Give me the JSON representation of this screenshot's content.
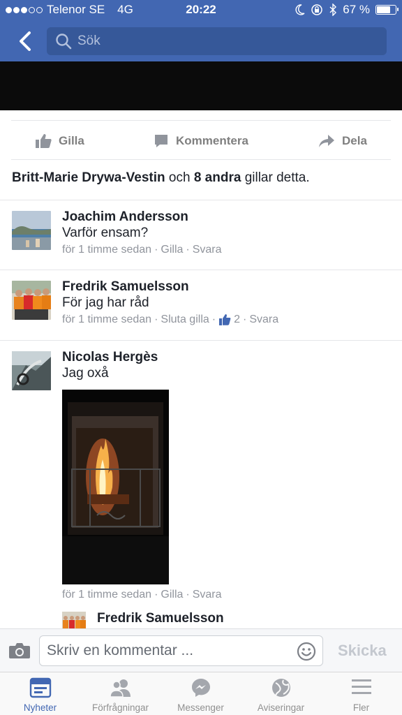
{
  "status_bar": {
    "carrier": "Telenor SE",
    "network": "4G",
    "time": "20:22",
    "battery": "67 %",
    "battery_level": 0.67,
    "signal_bars_filled": 3,
    "signal_bars_total": 5
  },
  "header": {
    "search_placeholder": "Sök",
    "accent_color": "#4267b2"
  },
  "actions": {
    "like": "Gilla",
    "comment": "Kommentera",
    "share": "Dela"
  },
  "likes_summary": {
    "first_name": "Britt-Marie Drywa-Vestin",
    "connector": "och",
    "others": "8 andra",
    "suffix": "gillar detta."
  },
  "comments": [
    {
      "author": "Joachim Andersson",
      "text": "Varför ensam?",
      "time": "för 1 timme sedan",
      "like_label": "Gilla",
      "reply_label": "Svara"
    },
    {
      "author": "Fredrik Samuelsson",
      "text": "För jag har råd",
      "time": "för 1 timme sedan",
      "like_label": "Sluta gilla",
      "like_count": "2",
      "reply_label": "Svara"
    },
    {
      "author": "Nicolas Hergès",
      "text": "Jag oxå",
      "time": "för 1 timme sedan",
      "like_label": "Gilla",
      "reply_label": "Svara"
    }
  ],
  "reply_preview": {
    "author": "Fredrik Samuelsson"
  },
  "composer": {
    "placeholder": "Skriv en kommentar ...",
    "send_label": "Skicka"
  },
  "tabs": [
    {
      "label": "Nyheter",
      "icon": "news-feed-icon",
      "active": true
    },
    {
      "label": "Förfrågningar",
      "icon": "friend-requests-icon",
      "active": false
    },
    {
      "label": "Messenger",
      "icon": "messenger-icon",
      "active": false
    },
    {
      "label": "Aviseringar",
      "icon": "globe-icon",
      "active": false
    },
    {
      "label": "Fler",
      "icon": "menu-icon",
      "active": false
    }
  ],
  "separator": "·"
}
